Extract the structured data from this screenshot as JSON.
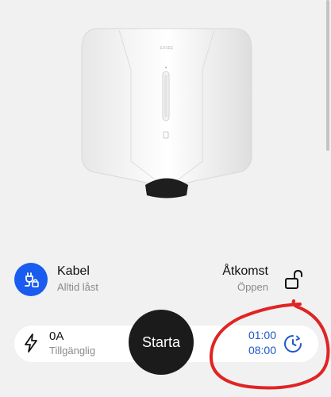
{
  "device": {
    "brand_mark": "EASEE"
  },
  "cable": {
    "title": "Kabel",
    "subtitle": "Alltid låst",
    "icon": "cable-lock-icon",
    "badge_color": "#1a5cf0"
  },
  "access": {
    "title": "Åtkomst",
    "subtitle": "Öppen",
    "icon": "unlocked-padlock-icon"
  },
  "status": {
    "current": "0A",
    "availability": "Tillgänglig",
    "icon": "lightning-bolt-icon"
  },
  "start_button": {
    "label": "Starta"
  },
  "schedule": {
    "start": "01:00",
    "end": "08:00",
    "icon": "schedule-clock-icon",
    "color": "#1f57c8"
  },
  "annotation": {
    "color": "#e02424"
  }
}
